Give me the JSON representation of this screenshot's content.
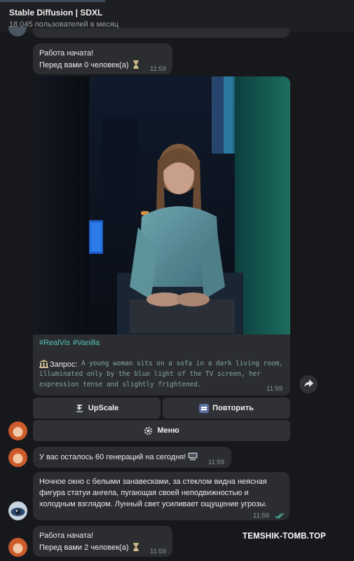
{
  "header": {
    "title": "Stable Diffusion | SDXL",
    "subtitle": "18 045 пользователей в месяц"
  },
  "msg1": {
    "line1": "Работа начата!",
    "line2": "Перед вами 0 человек(а)",
    "time": "11:59"
  },
  "image_post": {
    "tags": [
      "#RealVis",
      "#Vanilla"
    ],
    "query_label": "Запрос:",
    "query_text": "A young woman sits on a sofa in a dark living room, illuminated only by the blue light of the TV screen, her expression tense and slightly frightened.",
    "time": "11:59"
  },
  "buttons": {
    "upscale": "UpScale",
    "repeat": "Повторить",
    "menu": "Меню"
  },
  "msg2": {
    "text": "У вас осталось 60 генераций на сегодня!",
    "time": "11:59"
  },
  "msg3": {
    "text": "Ночное окно с белыми занавесками, за стеклом видна неясная фигура статуи ангела, пугающая своей неподвижностью и холодным взглядом. Лунный свет усиливает ощущение угрозы.",
    "time": "11:59"
  },
  "msg4": {
    "line1": "Работа начата!",
    "line2": "Перед вами 2 человек(а)",
    "time": "11:59"
  },
  "watermark": "TEMSHIK-TOMB.TOP",
  "colors": {
    "background": "#17181b",
    "bubble": "#2b2d31",
    "tag_accent": "#56c6b6",
    "query_mono": "#86a89d",
    "read_check": "#4fb3a5"
  },
  "icons": [
    "hourglass-icon",
    "classical-building-icon",
    "upscale-icon",
    "repeat-icon",
    "gear-icon",
    "computer-icon",
    "forward-icon",
    "double-check-icon"
  ]
}
